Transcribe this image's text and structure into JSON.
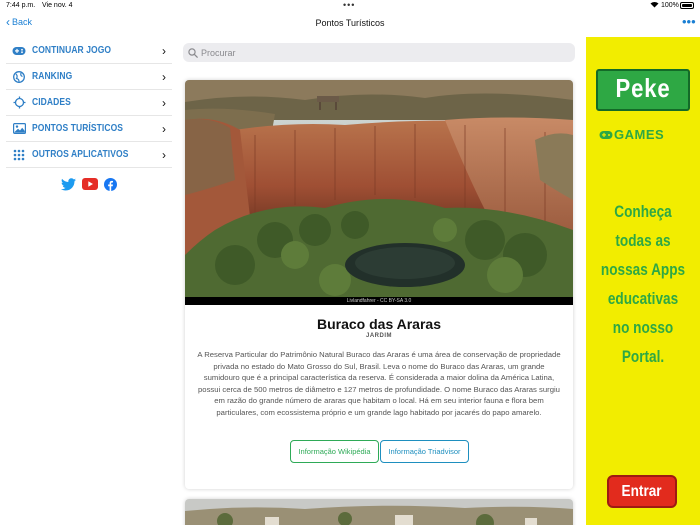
{
  "status_bar": {
    "time": "7:44 p.m.",
    "date": "Vie nov. 4",
    "battery": "100%"
  },
  "nav": {
    "back_label": "Back",
    "title": "Pontos Turísticos"
  },
  "sidebar": {
    "items": [
      {
        "label": "Continuar jogo",
        "icon": "gamepad-icon"
      },
      {
        "label": "Ranking",
        "icon": "globe-icon"
      },
      {
        "label": "Cidades",
        "icon": "crosshair-icon"
      },
      {
        "label": "Pontos turísticos",
        "icon": "image-icon"
      },
      {
        "label": "Outros aplicativos",
        "icon": "grid-icon"
      }
    ],
    "social": [
      "twitter-icon",
      "youtube-icon",
      "facebook-icon"
    ]
  },
  "search": {
    "placeholder": "Procurar"
  },
  "card": {
    "credit": "Livlandfahrer - CC BY-SA 3.0",
    "title": "Buraco das Araras",
    "subtitle": "JARDIM",
    "description": "A Reserva Particular do Patrimônio Natural Buraco das Araras é uma área de conservação de propriedade privada no estado do Mato Grosso do Sul, Brasil. Leva o nome do Buraco das Araras, um grande sumidouro que é a principal característica da reserva. É considerada a maior dolina da América Latina, possui cerca de 500 metros de diâmetro e 127 metros de profundidade. O nome Buraco das Araras surgiu em razão do grande número de araras que habitam o local. Há em seu interior fauna e flora bem particulares, com ecossistema próprio e um grande lago habitado por jacarés do papo amarelo.",
    "button_wiki": "Informação Wikipédia",
    "button_trip": "Informação Triadvisor"
  },
  "ad": {
    "logo_top": "Peke",
    "logo_bottom": "GAMES",
    "text": "Conheça todas as nossas Apps educativas no nosso Portal.",
    "button": "Entrar"
  },
  "colors": {
    "accent_blue": "#2f7fc6",
    "wiki_green": "#2eaa57",
    "trip_blue": "#1e8fbf",
    "ad_yellow": "#f2ed00",
    "ad_green": "#2ea844",
    "ad_red": "#e22b1d"
  }
}
